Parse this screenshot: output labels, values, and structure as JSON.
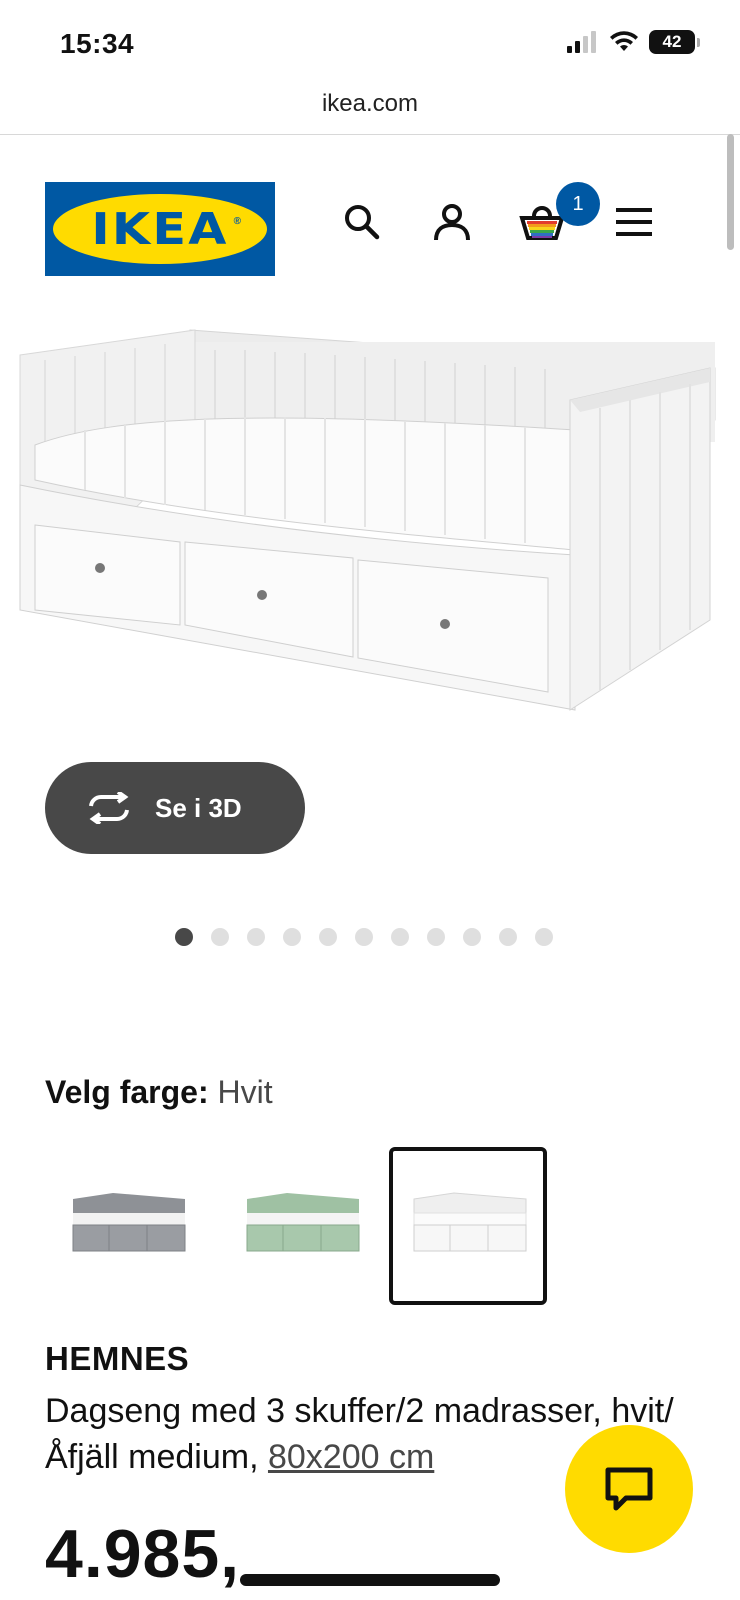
{
  "status": {
    "time": "15:34",
    "battery": "42"
  },
  "browser": {
    "url": "ikea.com"
  },
  "header": {
    "logo_text": "IKEA",
    "logo_mark": "®",
    "cart_count": "1",
    "icons": [
      "search-icon",
      "account-icon",
      "cart-icon",
      "menu-icon"
    ]
  },
  "gallery": {
    "view_3d_label": "Se i 3D",
    "dot_count": 11,
    "active_dot": 0
  },
  "color_picker": {
    "label": "Velg farge:",
    "selected_value": "Hvit",
    "options": [
      {
        "color": "#8e9196",
        "selected": false
      },
      {
        "color": "#9fc1a3",
        "selected": false
      },
      {
        "color": "#f4f4f4",
        "selected": true
      }
    ]
  },
  "product": {
    "name": "HEMNES",
    "description": "Dagseng med 3 skuffer/2 madrasser, hvit/Åfjäll medium, ",
    "dimension": "80x200 cm",
    "price": "4.985,"
  },
  "colors": {
    "brand_blue": "#0058a3",
    "brand_yellow": "#ffdb00",
    "button_dark": "#484848"
  }
}
